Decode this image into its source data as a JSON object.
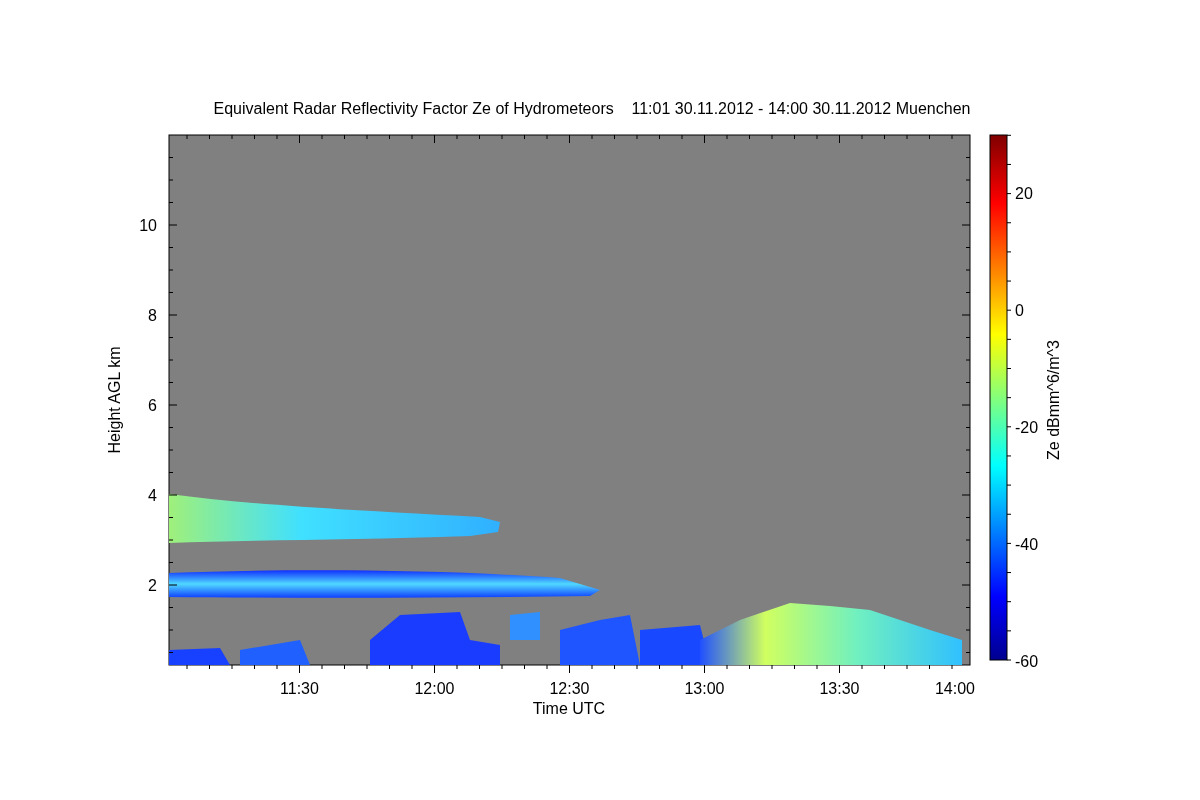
{
  "title": "Equivalent Radar Reflectivity Factor Ze of Hydrometeors    11:01 30.11.2012 - 14:00 30.11.2012 Muenchen",
  "y_axis": {
    "label": "Height AGL km",
    "ticks": [
      "10",
      "8",
      "6",
      "4",
      "2"
    ]
  },
  "x_axis": {
    "label": "Time UTC",
    "ticks": [
      "11:30",
      "12:00",
      "12:30",
      "13:00",
      "13:30",
      "14:00"
    ]
  },
  "colorbar": {
    "label": "Ze dBmm^6/m^3",
    "ticks": [
      "20",
      "0",
      "-20",
      "-40",
      "-60"
    ]
  }
}
